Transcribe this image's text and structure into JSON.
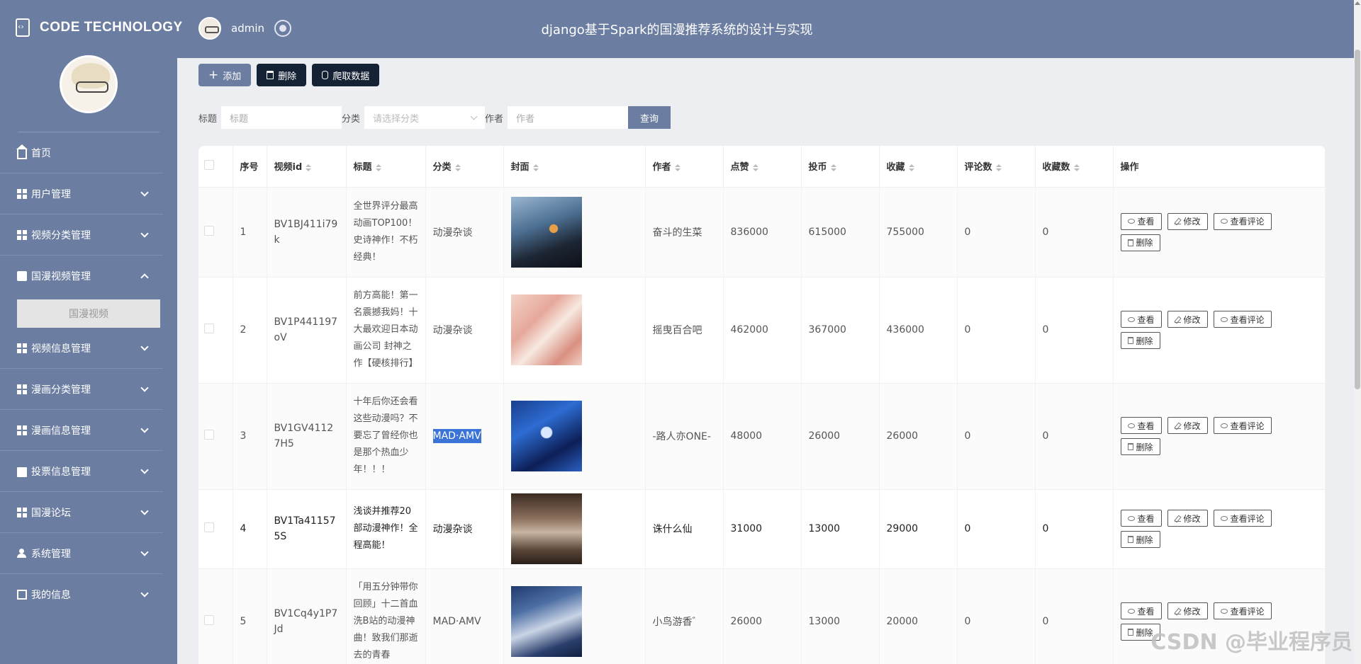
{
  "header": {
    "brand": "CODE TECHNOLOGY",
    "username": "admin",
    "title": "django基于Spark的国漫推荐系统的设计与实现"
  },
  "sidebar": {
    "items": [
      {
        "label": "首页",
        "icon": "home-icon"
      },
      {
        "label": "用户管理",
        "icon": "grid-icon"
      },
      {
        "label": "视频分类管理",
        "icon": "grid-icon"
      },
      {
        "label": "国漫视频管理",
        "icon": "chat-icon",
        "expanded": true
      },
      {
        "label": "视频信息管理",
        "icon": "grid-icon"
      },
      {
        "label": "漫画分类管理",
        "icon": "grid-icon"
      },
      {
        "label": "漫画信息管理",
        "icon": "grid-icon"
      },
      {
        "label": "投票信息管理",
        "icon": "vote-icon"
      },
      {
        "label": "国漫论坛",
        "icon": "grid-icon"
      },
      {
        "label": "系统管理",
        "icon": "user-icon"
      },
      {
        "label": "我的信息",
        "icon": "card-icon"
      }
    ],
    "submenu": {
      "label": "国漫视频"
    }
  },
  "toolbar": {
    "add_label": "添加",
    "delete_label": "删除",
    "crawl_label": "爬取数据"
  },
  "filters": {
    "title_label": "标题",
    "title_placeholder": "标题",
    "category_label": "分类",
    "category_placeholder": "请选择分类",
    "author_label": "作者",
    "author_placeholder": "作者",
    "query_label": "查询"
  },
  "table": {
    "columns": [
      "序号",
      "视频id",
      "标题",
      "分类",
      "封面",
      "作者",
      "点赞",
      "投币",
      "收藏",
      "评论数",
      "收藏数",
      "操作"
    ],
    "rows": [
      {
        "no": "1",
        "vid": "BV1BJ411i79k",
        "title": "全世界评分最高动画TOP100！史诗神作！不朽经典！",
        "category": "动漫杂谈",
        "author": "奋斗的生菜",
        "likes": "836000",
        "coins": "615000",
        "favorites": "755000",
        "comments": "0",
        "collects": "0"
      },
      {
        "no": "2",
        "vid": "BV1P441197oV",
        "title": "前方高能！第一名震撼我妈！十大最欢迎日本动画公司 封神之作【硬核排行】",
        "category": "动漫杂谈",
        "author": "摇曳百合吧",
        "likes": "462000",
        "coins": "367000",
        "favorites": "436000",
        "comments": "0",
        "collects": "0"
      },
      {
        "no": "3",
        "vid": "BV1GV41127H5",
        "title": "十年后你还会看这些动漫吗？不要忘了曾经你也是那个热血少年！！！",
        "category": "MAD·AMV",
        "author": "-路人亦ONE-",
        "likes": "48000",
        "coins": "26000",
        "favorites": "26000",
        "comments": "0",
        "collects": "0"
      },
      {
        "no": "4",
        "vid": "BV1Ta411575S",
        "title": "浅谈并推荐20部动漫神作！全程高能！",
        "category": "动漫杂谈",
        "author": "诛什么仙",
        "likes": "31000",
        "coins": "13000",
        "favorites": "29000",
        "comments": "0",
        "collects": "0"
      },
      {
        "no": "5",
        "vid": "BV1Cq4y1P7Jd",
        "title": "「用五分钟带你回顾」十二首血洗B站的动漫神曲！致我们那逝去的青春",
        "category": "MAD·AMV",
        "author": "小鸟游香゛",
        "likes": "26000",
        "coins": "13000",
        "favorites": "20000",
        "comments": "0",
        "collects": "0"
      }
    ],
    "actions": {
      "view": "查看",
      "edit": "修改",
      "view_comments": "查看评论",
      "delete": "删除"
    }
  },
  "watermark": "CSDN @毕业程序员"
}
